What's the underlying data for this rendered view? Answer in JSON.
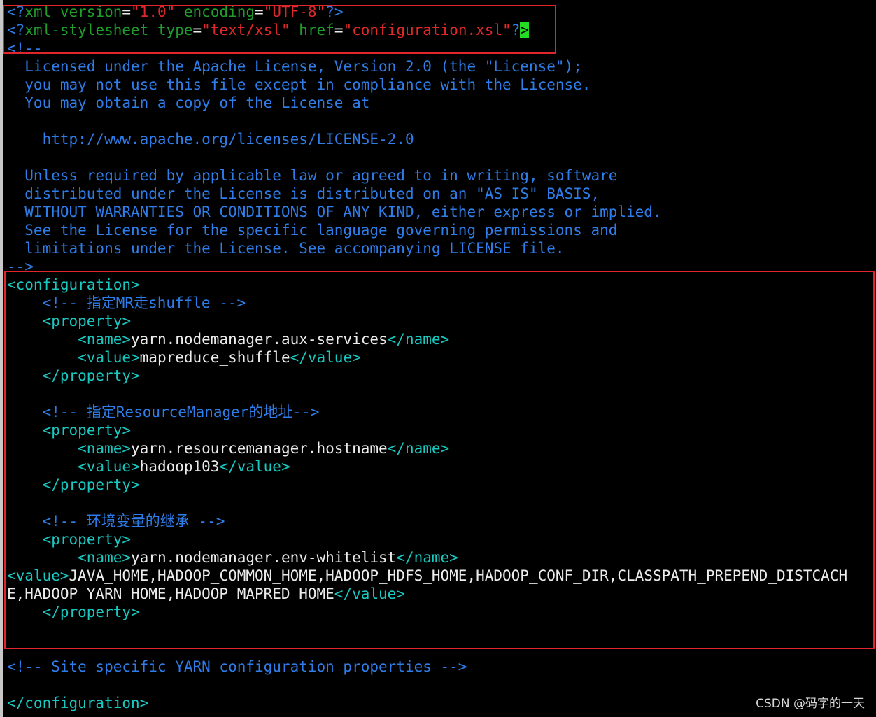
{
  "colors": {
    "background": "#000000",
    "tag": "#19c8c0",
    "comment": "#2e7de8",
    "text": "#ececec",
    "string": "#e02828",
    "attr": "#1f9e2b",
    "highlight_box": "#e0252c",
    "cursor": "#22dd22"
  },
  "lines": [
    [
      {
        "t": "<?",
        "c": "comment"
      },
      {
        "t": "xml version",
        "c": "attr"
      },
      {
        "t": "=",
        "c": "text"
      },
      {
        "t": "\"1.0\"",
        "c": "string"
      },
      {
        "t": " encoding",
        "c": "attr"
      },
      {
        "t": "=",
        "c": "text"
      },
      {
        "t": "\"UTF-8\"",
        "c": "string"
      },
      {
        "t": "?>",
        "c": "comment"
      }
    ],
    [
      {
        "t": "<?",
        "c": "comment"
      },
      {
        "t": "xml-stylesheet type",
        "c": "attr"
      },
      {
        "t": "=",
        "c": "text"
      },
      {
        "t": "\"text/xsl\"",
        "c": "string"
      },
      {
        "t": " href",
        "c": "attr"
      },
      {
        "t": "=",
        "c": "text"
      },
      {
        "t": "\"configuration.xsl\"",
        "c": "string"
      },
      {
        "t": "?",
        "c": "comment"
      },
      {
        "t": ">",
        "c": "cursor"
      }
    ],
    [
      {
        "t": "<!--",
        "c": "comment"
      }
    ],
    [
      {
        "t": "  Licensed under the Apache License, Version 2.0 (the \"License\");",
        "c": "comment"
      }
    ],
    [
      {
        "t": "  you may not use this file except in compliance with the License.",
        "c": "comment"
      }
    ],
    [
      {
        "t": "  You may obtain a copy of the License at",
        "c": "comment"
      }
    ],
    [],
    [
      {
        "t": "    http://www.apache.org/licenses/LICENSE-2.0",
        "c": "comment"
      }
    ],
    [],
    [
      {
        "t": "  Unless required by applicable law or agreed to in writing, software",
        "c": "comment"
      }
    ],
    [
      {
        "t": "  distributed under the License is distributed on an \"AS IS\" BASIS,",
        "c": "comment"
      }
    ],
    [
      {
        "t": "  WITHOUT WARRANTIES OR CONDITIONS OF ANY KIND, either express or implied.",
        "c": "comment"
      }
    ],
    [
      {
        "t": "  See the License for the specific language governing permissions and",
        "c": "comment"
      }
    ],
    [
      {
        "t": "  limitations under the License. See accompanying LICENSE file.",
        "c": "comment"
      }
    ],
    [
      {
        "t": "-->",
        "c": "comment"
      }
    ],
    [
      {
        "t": "<configuration>",
        "c": "tag"
      }
    ],
    [
      {
        "t": "    <!-- 指定MR走shuffle -->",
        "c": "comment"
      }
    ],
    [
      {
        "t": "    <property>",
        "c": "tag"
      }
    ],
    [
      {
        "t": "        <name>",
        "c": "tag"
      },
      {
        "t": "yarn.nodemanager.aux-services",
        "c": "text"
      },
      {
        "t": "</name>",
        "c": "tag"
      }
    ],
    [
      {
        "t": "        <value>",
        "c": "tag"
      },
      {
        "t": "mapreduce_shuffle",
        "c": "text"
      },
      {
        "t": "</value>",
        "c": "tag"
      }
    ],
    [
      {
        "t": "    </property>",
        "c": "tag"
      }
    ],
    [],
    [
      {
        "t": "    <!-- 指定ResourceManager的地址-->",
        "c": "comment"
      }
    ],
    [
      {
        "t": "    <property>",
        "c": "tag"
      }
    ],
    [
      {
        "t": "        <name>",
        "c": "tag"
      },
      {
        "t": "yarn.resourcemanager.hostname",
        "c": "text"
      },
      {
        "t": "</name>",
        "c": "tag"
      }
    ],
    [
      {
        "t": "        <value>",
        "c": "tag"
      },
      {
        "t": "hadoop103",
        "c": "text"
      },
      {
        "t": "</value>",
        "c": "tag"
      }
    ],
    [
      {
        "t": "    </property>",
        "c": "tag"
      }
    ],
    [],
    [
      {
        "t": "    <!-- 环境变量的继承 -->",
        "c": "comment"
      }
    ],
    [
      {
        "t": "    <property>",
        "c": "tag"
      }
    ],
    [
      {
        "t": "        <name>",
        "c": "tag"
      },
      {
        "t": "yarn.nodemanager.env-whitelist",
        "c": "text"
      },
      {
        "t": "</name>",
        "c": "tag"
      }
    ],
    [
      {
        "t": "<value>",
        "c": "tag"
      },
      {
        "t": "JAVA_HOME,HADOOP_COMMON_HOME,HADOOP_HDFS_HOME,HADOOP_CONF_DIR,CLASSPATH_PREPEND_DISTCACH",
        "c": "text"
      }
    ],
    [
      {
        "t": "E,HADOOP_YARN_HOME,HADOOP_MAPRED_HOME",
        "c": "text"
      },
      {
        "t": "</value>",
        "c": "tag"
      }
    ],
    [
      {
        "t": "    </property>",
        "c": "tag"
      }
    ],
    [],
    [],
    [
      {
        "t": "<!-- Site specific YARN configuration properties -->",
        "c": "comment"
      }
    ],
    [],
    [
      {
        "t": "</configuration>",
        "c": "tag"
      }
    ]
  ],
  "watermark": "CSDN @码字的一天"
}
